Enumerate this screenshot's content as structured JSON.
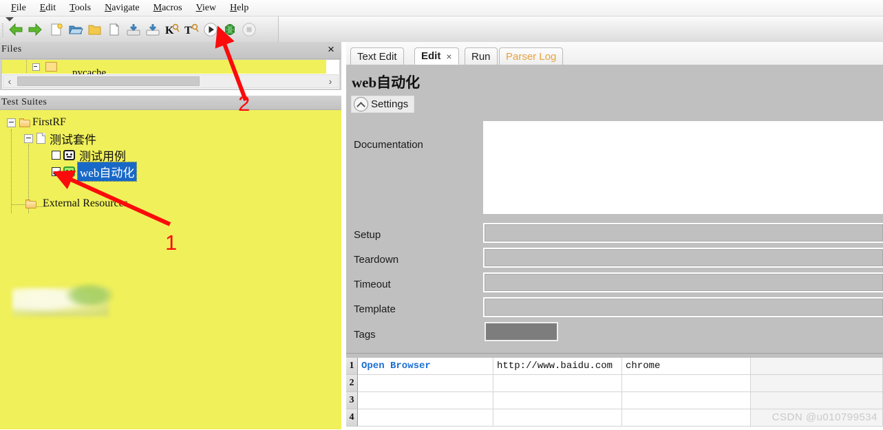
{
  "menubar": {
    "items": [
      {
        "mnemonic": "F",
        "rest": "ile"
      },
      {
        "mnemonic": "E",
        "rest": "dit"
      },
      {
        "mnemonic": "T",
        "rest": "ools"
      },
      {
        "mnemonic": "N",
        "rest": "avigate"
      },
      {
        "mnemonic": "M",
        "rest": "acros"
      },
      {
        "mnemonic": "V",
        "rest": "iew"
      },
      {
        "mnemonic": "H",
        "rest": "elp"
      }
    ]
  },
  "toolbar": {
    "icons": [
      "back-arrow-icon",
      "forward-arrow-icon",
      "new-file-icon",
      "open-folder-icon",
      "new-directory-icon",
      "new-document-icon",
      "save-icon",
      "save-all-icon",
      "search-keyword-icon",
      "search-test-icon",
      "run-icon",
      "debug-icon",
      "stop-icon"
    ]
  },
  "files_panel": {
    "title": "Files",
    "close_label": "×",
    "row_label": "pycache",
    "scroll_left": "‹",
    "scroll_right": "›"
  },
  "test_suites": {
    "title": "Test Suites",
    "nodes": [
      {
        "label": "FirstRF",
        "icon": "folder-icon",
        "checkbox": null,
        "selected": false
      },
      {
        "label": "测试套件",
        "icon": "document-icon",
        "checkbox": null,
        "selected": false
      },
      {
        "label": "测试用例",
        "icon": "robot-icon",
        "checkbox": "unchecked",
        "selected": false
      },
      {
        "label": "web自动化",
        "icon": "robot-icon-green",
        "checkbox": "checked",
        "selected": true
      },
      {
        "label": "External Resources",
        "icon": "folder-icon",
        "checkbox": null,
        "selected": false
      }
    ]
  },
  "editor": {
    "tabs": [
      {
        "label": "Text Edit",
        "active": false,
        "closable": false,
        "accent": false
      },
      {
        "label": "Edit",
        "active": true,
        "closable": true,
        "accent": false,
        "close_label": "×"
      },
      {
        "label": "Run",
        "active": false,
        "closable": false,
        "accent": false
      },
      {
        "label": "Parser Log",
        "active": false,
        "closable": false,
        "accent": true
      }
    ],
    "title": "web自动化",
    "settings_button": "Settings",
    "fields": [
      {
        "label": "Documentation",
        "value": "",
        "type": "textarea"
      },
      {
        "label": "Setup",
        "value": "",
        "type": "text"
      },
      {
        "label": "Teardown",
        "value": "",
        "type": "text"
      },
      {
        "label": "Timeout",
        "value": "",
        "type": "text"
      },
      {
        "label": "Template",
        "value": "",
        "type": "text"
      },
      {
        "label": "Tags",
        "value": "",
        "type": "tag"
      }
    ]
  },
  "grid": {
    "rows": [
      {
        "num": "1",
        "cells": [
          "Open Browser",
          "http://www.baidu.com",
          "chrome",
          ""
        ]
      },
      {
        "num": "2",
        "cells": [
          "",
          "",
          "",
          ""
        ]
      },
      {
        "num": "3",
        "cells": [
          "",
          "",
          "",
          ""
        ]
      },
      {
        "num": "4",
        "cells": [
          "",
          "",
          "",
          ""
        ]
      }
    ]
  },
  "annotations": [
    {
      "label": "1",
      "color": "#fb0b0b"
    },
    {
      "label": "2",
      "color": "#fb0b0b"
    }
  ],
  "watermark": "CSDN @u010799534",
  "colors": {
    "tree_background": "#f0f05a",
    "selection": "#1868c7",
    "keyword": "#1b6fd4",
    "accent_tab": "#e8a33d",
    "annotation": "#fb0b0b"
  }
}
